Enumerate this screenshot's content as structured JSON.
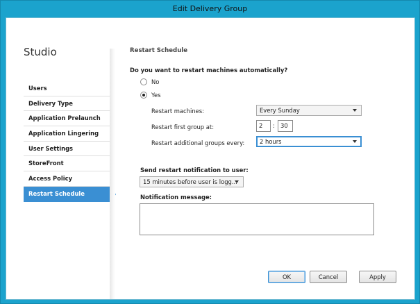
{
  "window": {
    "title": "Edit Delivery Group"
  },
  "sidebar": {
    "title": "Studio",
    "items": [
      {
        "label": "Users",
        "active": false
      },
      {
        "label": "Delivery Type",
        "active": false
      },
      {
        "label": "Application Prelaunch",
        "active": false
      },
      {
        "label": "Application Lingering",
        "active": false
      },
      {
        "label": "User Settings",
        "active": false
      },
      {
        "label": "StoreFront",
        "active": false
      },
      {
        "label": "Access Policy",
        "active": false
      },
      {
        "label": "Restart Schedule",
        "active": true
      }
    ]
  },
  "main": {
    "section_title": "Restart Schedule",
    "question": "Do you want to restart machines automatically?",
    "options": [
      {
        "label": "No",
        "checked": false
      },
      {
        "label": "Yes",
        "checked": true
      }
    ],
    "restart_machines": {
      "label": "Restart machines:",
      "value": "Every Sunday"
    },
    "first_group": {
      "label": "Restart first group at:",
      "hour": "2",
      "minute": "30",
      "separator": ":"
    },
    "additional_groups": {
      "label": "Restart additional groups every:",
      "value": "2 hours"
    },
    "notification": {
      "label": "Send restart notification to user:",
      "value": "15 minutes before user is logg..."
    },
    "message": {
      "label": "Notification message:",
      "value": ""
    }
  },
  "buttons": {
    "ok": "OK",
    "cancel": "Cancel",
    "apply": "Apply"
  },
  "colors": {
    "chrome": "#1ba3cd",
    "accent": "#3a8fd3"
  }
}
